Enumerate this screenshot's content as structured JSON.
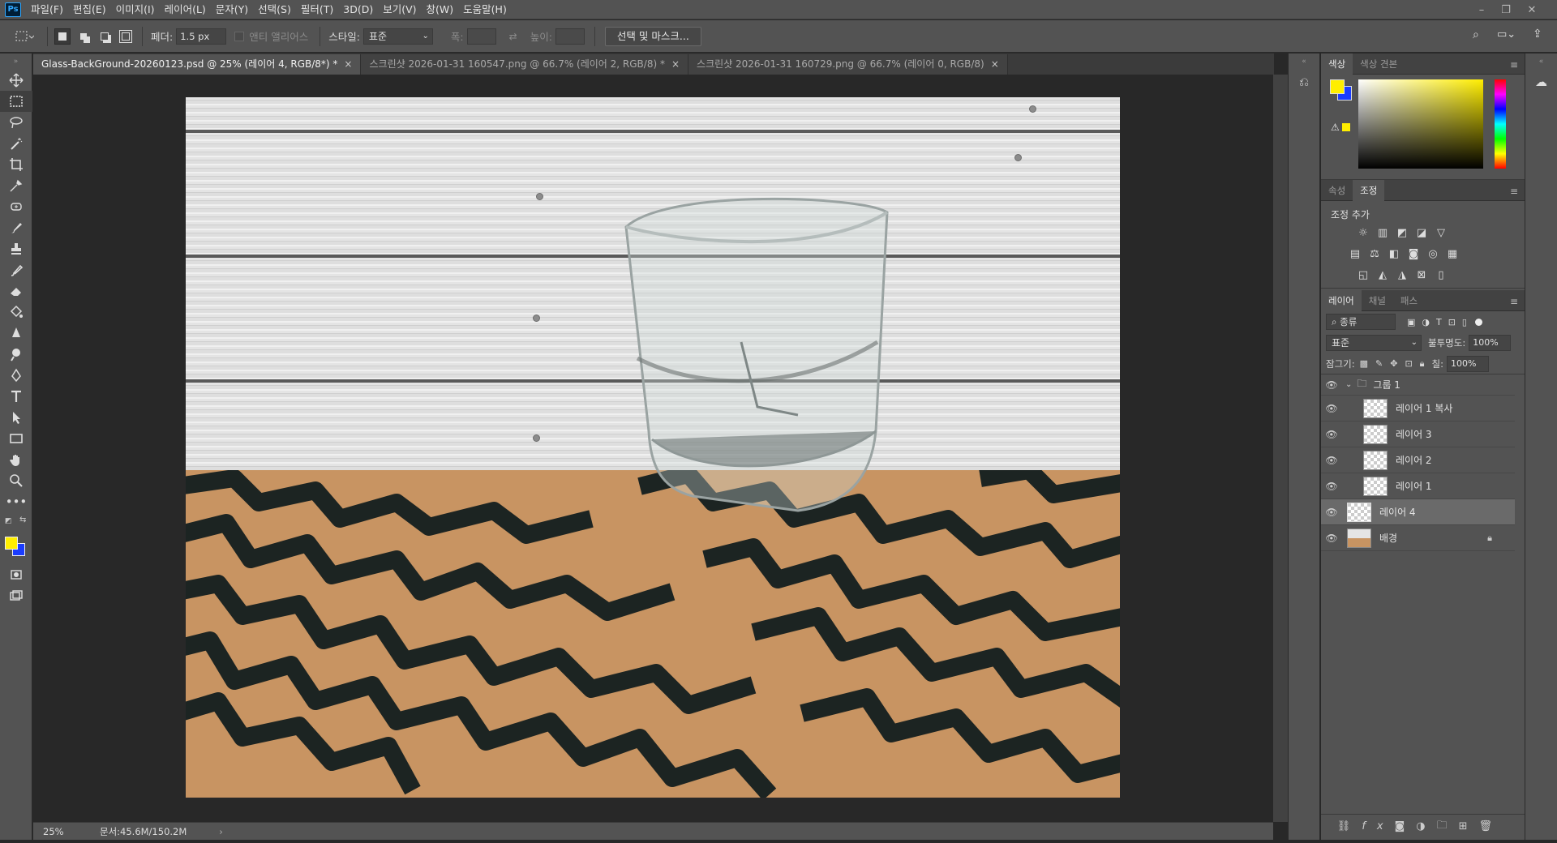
{
  "app": {
    "logo": "Ps"
  },
  "menu": [
    "파일(F)",
    "편집(E)",
    "이미지(I)",
    "레이어(L)",
    "문자(Y)",
    "선택(S)",
    "필터(T)",
    "3D(D)",
    "보기(V)",
    "창(W)",
    "도움말(H)"
  ],
  "options": {
    "feather_label": "페더:",
    "feather_value": "1.5 px",
    "antialias_label": "앤티 앨리어스",
    "style_label": "스타일:",
    "style_value": "표준",
    "width_label": "폭:",
    "height_label": "높이:",
    "select_mask_button": "선택 및 마스크..."
  },
  "tabs": [
    {
      "label": "Glass-BackGround-20260123.psd @ 25% (레이어 4, RGB/8*) *",
      "active": true
    },
    {
      "label": "스크린샷 2026-01-31 160547.png @ 66.7% (레이어 2, RGB/8) *",
      "active": false
    },
    {
      "label": "스크린샷 2026-01-31 160729.png @ 66.7% (레이어 0, RGB/8)",
      "active": false
    }
  ],
  "status": {
    "zoom": "25%",
    "doc": "문서:45.6M/150.2M"
  },
  "color_panel": {
    "tabs": [
      "색상",
      "색상 견본"
    ],
    "foreground": "#ffee00",
    "background": "#1a3cff"
  },
  "adjust_panel": {
    "tabs": [
      "속성",
      "조정"
    ],
    "title": "조정 추가"
  },
  "layers_panel": {
    "tabs": [
      "레이어",
      "채널",
      "패스"
    ],
    "filter_label": "종류",
    "blend_mode": "표준",
    "opacity_label": "불투명도:",
    "opacity_value": "100%",
    "lock_label": "잠그기:",
    "fill_label": "칠:",
    "fill_value": "100%",
    "layers": [
      {
        "name": "그룹 1",
        "type": "group"
      },
      {
        "name": "레이어 1 복사",
        "type": "layer"
      },
      {
        "name": "레이어 3",
        "type": "layer"
      },
      {
        "name": "레이어 2",
        "type": "layer"
      },
      {
        "name": "레이어 1",
        "type": "layer"
      },
      {
        "name": "레이어 4",
        "type": "layer",
        "selected": true
      },
      {
        "name": "배경",
        "type": "background",
        "locked": true
      }
    ]
  },
  "close_glyph": "×"
}
